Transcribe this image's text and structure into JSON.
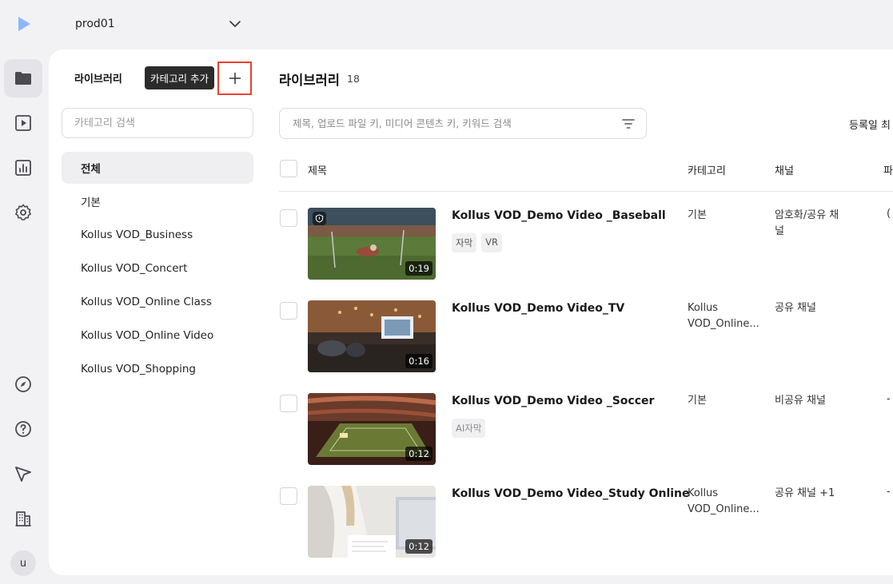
{
  "workspace": {
    "name": "prod01"
  },
  "sidebar": {
    "avatar_letter": "u",
    "items": [
      {
        "icon": "folder-icon",
        "active": true
      },
      {
        "icon": "play-icon",
        "active": false
      },
      {
        "icon": "chart-icon",
        "active": false
      },
      {
        "icon": "gear-icon",
        "active": false
      },
      {
        "icon": "compass-icon",
        "active": false
      },
      {
        "icon": "help-icon",
        "active": false
      },
      {
        "icon": "send-icon",
        "active": false
      },
      {
        "icon": "building-icon",
        "active": false
      }
    ]
  },
  "categories": {
    "title": "라이브러리",
    "tooltip": "카테고리 추가",
    "add_button_icon": "plus-icon",
    "search_placeholder": "카테고리 검색",
    "items": [
      {
        "label": "전체",
        "active": true
      },
      {
        "label": "기본"
      },
      {
        "label": "Kollus VOD_Business"
      },
      {
        "label": "Kollus VOD_Concert"
      },
      {
        "label": "Kollus VOD_Online Class"
      },
      {
        "label": "Kollus VOD_Online Video"
      },
      {
        "label": "Kollus VOD_Shopping"
      }
    ]
  },
  "library": {
    "title": "라이브러리",
    "count": "18",
    "search_placeholder": "제목, 업로드 파일 키, 미디어 콘텐츠 키, 키워드 검색",
    "sort_label": "등록일 최",
    "columns": {
      "title": "제목",
      "category": "카테고리",
      "channel": "채널",
      "extra": "파"
    },
    "rows": [
      {
        "title": "Kollus VOD_Demo Video _Baseball",
        "duration": "0:19",
        "drm": true,
        "tags": [
          {
            "label": "자막"
          },
          {
            "label": "VR"
          }
        ],
        "category": "기본",
        "channel": "암호화/공유 채널",
        "extra": "("
      },
      {
        "title": "Kollus VOD_Demo Video_TV",
        "duration": "0:16",
        "drm": false,
        "tags": [],
        "category": "Kollus VOD_Online...",
        "channel": "공유 채널",
        "extra": ""
      },
      {
        "title": "Kollus VOD_Demo Video _Soccer",
        "duration": "0:12",
        "drm": false,
        "tags": [
          {
            "label": "AI자막",
            "muted": true
          }
        ],
        "category": "기본",
        "channel": "비공유 채널",
        "extra": "-"
      },
      {
        "title": "Kollus VOD_Demo Video_Study Online",
        "duration": "0:12",
        "drm": false,
        "tags": [],
        "category": "Kollus VOD_Online...",
        "channel": "공유 채널 +1",
        "extra": "-"
      }
    ]
  }
}
